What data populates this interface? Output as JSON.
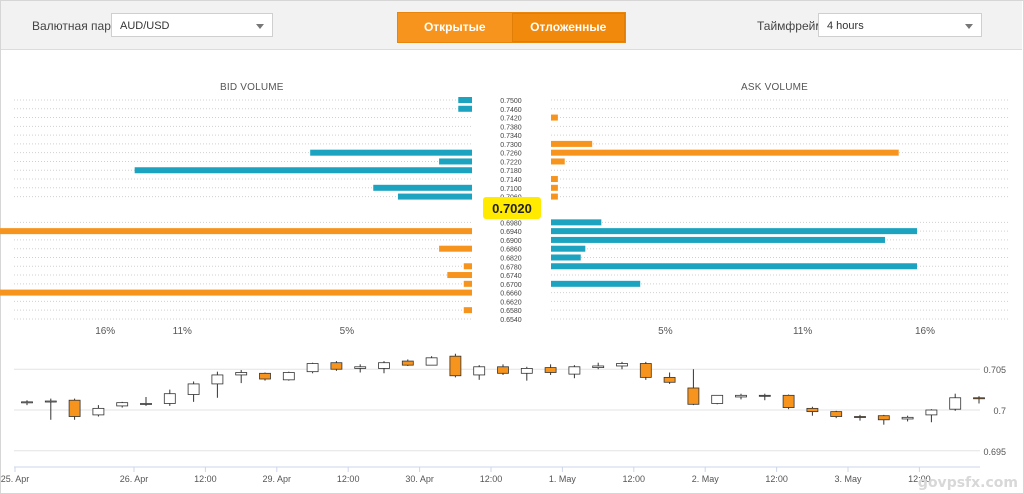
{
  "toolbar": {
    "pair_label": "Валютная пара",
    "pair_value": "AUD/USD",
    "tabs": [
      "Открытые",
      "Отложенные"
    ],
    "timeframe_label": "Таймфрейм",
    "timeframe_value": "4 hours"
  },
  "colors": {
    "bid_primary": "#1ba3bf",
    "ask_primary": "#f7941d",
    "price_highlight": "#ffea00"
  },
  "chart_data": [
    {
      "type": "bar",
      "orientation": "horizontal",
      "title_bid": "BID VOLUME",
      "title_ask": "ASK VOLUME",
      "current_price": "0.7020",
      "price_levels": [
        "0.7500",
        "0.7460",
        "0.7420",
        "0.7380",
        "0.7340",
        "0.7300",
        "0.7260",
        "0.7220",
        "0.7180",
        "0.7140",
        "0.7100",
        "0.7060",
        "0.6980",
        "0.6940",
        "0.6900",
        "0.6860",
        "0.6820",
        "0.6780",
        "0.6740",
        "0.6700",
        "0.6660",
        "0.6620",
        "0.6580",
        "0.6540"
      ],
      "bid": [
        {
          "price": "0.7500",
          "value": 0.5,
          "color": "teal"
        },
        {
          "price": "0.7460",
          "value": 0.5,
          "color": "teal"
        },
        {
          "price": "0.7420",
          "value": 0,
          "color": ""
        },
        {
          "price": "0.7380",
          "value": 0,
          "color": ""
        },
        {
          "price": "0.7340",
          "value": 0,
          "color": ""
        },
        {
          "price": "0.7300",
          "value": 0,
          "color": ""
        },
        {
          "price": "0.7260",
          "value": 5.9,
          "color": "teal"
        },
        {
          "price": "0.7220",
          "value": 1.2,
          "color": "teal"
        },
        {
          "price": "0.7180",
          "value": 12.3,
          "color": "teal"
        },
        {
          "price": "0.7140",
          "value": 0,
          "color": ""
        },
        {
          "price": "0.7100",
          "value": 3.6,
          "color": "teal"
        },
        {
          "price": "0.7060",
          "value": 2.7,
          "color": "teal"
        },
        {
          "price": "0.6980",
          "value": 0,
          "color": ""
        },
        {
          "price": "0.6940",
          "value": 40.0,
          "color": "orange"
        },
        {
          "price": "0.6900",
          "value": 0,
          "color": ""
        },
        {
          "price": "0.6860",
          "value": 1.2,
          "color": "orange"
        },
        {
          "price": "0.6820",
          "value": 0,
          "color": ""
        },
        {
          "price": "0.6780",
          "value": 0.3,
          "color": "orange"
        },
        {
          "price": "0.6740",
          "value": 0.9,
          "color": "orange"
        },
        {
          "price": "0.6700",
          "value": 0.3,
          "color": "orange"
        },
        {
          "price": "0.6660",
          "value": 30.0,
          "color": "orange"
        },
        {
          "price": "0.6620",
          "value": 0,
          "color": ""
        },
        {
          "price": "0.6580",
          "value": 0.3,
          "color": "orange"
        },
        {
          "price": "0.6540",
          "value": 0,
          "color": ""
        }
      ],
      "ask": [
        {
          "price": "0.7500",
          "value": 0,
          "color": ""
        },
        {
          "price": "0.7460",
          "value": 0,
          "color": ""
        },
        {
          "price": "0.7420",
          "value": 0.3,
          "color": "orange"
        },
        {
          "price": "0.7380",
          "value": 0,
          "color": ""
        },
        {
          "price": "0.7340",
          "value": 0,
          "color": ""
        },
        {
          "price": "0.7300",
          "value": 1.8,
          "color": "orange"
        },
        {
          "price": "0.7260",
          "value": 15.2,
          "color": "orange"
        },
        {
          "price": "0.7220",
          "value": 0.6,
          "color": "orange"
        },
        {
          "price": "0.7180",
          "value": 0,
          "color": ""
        },
        {
          "price": "0.7140",
          "value": 0.3,
          "color": "orange"
        },
        {
          "price": "0.7100",
          "value": 0.3,
          "color": "orange"
        },
        {
          "price": "0.7060",
          "value": 0.3,
          "color": "orange"
        },
        {
          "price": "0.6980",
          "value": 2.2,
          "color": "teal"
        },
        {
          "price": "0.6940",
          "value": 16.0,
          "color": "teal"
        },
        {
          "price": "0.6900",
          "value": 14.6,
          "color": "teal"
        },
        {
          "price": "0.6860",
          "value": 1.5,
          "color": "teal"
        },
        {
          "price": "0.6820",
          "value": 1.3,
          "color": "teal"
        },
        {
          "price": "0.6780",
          "value": 16.0,
          "color": "teal"
        },
        {
          "price": "0.6740",
          "value": 0,
          "color": ""
        },
        {
          "price": "0.6700",
          "value": 3.9,
          "color": "teal"
        },
        {
          "price": "0.6660",
          "value": 0,
          "color": ""
        },
        {
          "price": "0.6620",
          "value": 0,
          "color": ""
        },
        {
          "price": "0.6580",
          "value": 0,
          "color": ""
        },
        {
          "price": "0.6540",
          "value": 0,
          "color": ""
        }
      ],
      "bid_ticks": [
        {
          "label": "16%",
          "value": 16
        },
        {
          "label": "11%",
          "value": 11
        },
        {
          "label": "5%",
          "value": 5
        }
      ],
      "ask_ticks": [
        {
          "label": "5%",
          "value": 5
        },
        {
          "label": "11%",
          "value": 11
        },
        {
          "label": "16%",
          "value": 16
        }
      ],
      "xlim": [
        0,
        17
      ]
    },
    {
      "type": "candlestick",
      "ylim": [
        0.6935,
        0.7065
      ],
      "y_ticks": [
        {
          "label": "0.705",
          "value": 0.705
        },
        {
          "label": "0.7",
          "value": 0.7
        },
        {
          "label": "0.695",
          "value": 0.695
        }
      ],
      "x_labels": [
        "25. Apr",
        "26. Apr",
        "12:00",
        "29. Apr",
        "12:00",
        "30. Apr",
        "12:00",
        "1. May",
        "12:00",
        "2. May",
        "12:00",
        "3. May",
        "12:00"
      ],
      "x_label_index": [
        0,
        5,
        8,
        11,
        14,
        17,
        20,
        23,
        26,
        29,
        32,
        35,
        38
      ],
      "candles": [
        [
          0.7009,
          0.7012,
          0.7006,
          0.701
        ],
        [
          0.701,
          0.7014,
          0.6988,
          0.7011
        ],
        [
          0.7012,
          0.7014,
          0.6988,
          0.6992
        ],
        [
          0.6994,
          0.7006,
          0.6992,
          0.7002
        ],
        [
          0.7005,
          0.701,
          0.7003,
          0.7009
        ],
        [
          0.7007,
          0.7016,
          0.7005,
          0.7008
        ],
        [
          0.7008,
          0.7025,
          0.7005,
          0.702
        ],
        [
          0.7019,
          0.7035,
          0.701,
          0.7032
        ],
        [
          0.7032,
          0.7047,
          0.7015,
          0.7043
        ],
        [
          0.7043,
          0.7049,
          0.7033,
          0.7046
        ],
        [
          0.7045,
          0.7046,
          0.7036,
          0.7038
        ],
        [
          0.7037,
          0.7047,
          0.7036,
          0.7046
        ],
        [
          0.7047,
          0.7058,
          0.7045,
          0.7057
        ],
        [
          0.7058,
          0.706,
          0.7048,
          0.705
        ],
        [
          0.7051,
          0.7056,
          0.7046,
          0.7053
        ],
        [
          0.7051,
          0.706,
          0.7045,
          0.7058
        ],
        [
          0.706,
          0.7062,
          0.7054,
          0.7055
        ],
        [
          0.7055,
          0.7066,
          0.7055,
          0.7064
        ],
        [
          0.7066,
          0.7069,
          0.704,
          0.7042
        ],
        [
          0.7043,
          0.7055,
          0.7037,
          0.7053
        ],
        [
          0.7053,
          0.7056,
          0.7043,
          0.7045
        ],
        [
          0.7045,
          0.7053,
          0.7036,
          0.7051
        ],
        [
          0.7052,
          0.7056,
          0.7043,
          0.7046
        ],
        [
          0.7044,
          0.7055,
          0.7039,
          0.7053
        ],
        [
          0.7052,
          0.7058,
          0.705,
          0.7054
        ],
        [
          0.7054,
          0.7059,
          0.705,
          0.7057
        ],
        [
          0.7057,
          0.7059,
          0.7037,
          0.704
        ],
        [
          0.704,
          0.7046,
          0.7032,
          0.7034
        ],
        [
          0.7027,
          0.705,
          0.7006,
          0.7007
        ],
        [
          0.7008,
          0.7018,
          0.7007,
          0.7018
        ],
        [
          0.7016,
          0.702,
          0.7013,
          0.7018
        ],
        [
          0.7018,
          0.702,
          0.7012,
          0.7017
        ],
        [
          0.7018,
          0.7019,
          0.7001,
          0.7003
        ],
        [
          0.7002,
          0.7004,
          0.6993,
          0.6998
        ],
        [
          0.6998,
          0.6999,
          0.699,
          0.6992
        ],
        [
          0.6992,
          0.6994,
          0.6987,
          0.6991
        ],
        [
          0.6993,
          0.6994,
          0.6982,
          0.6988
        ],
        [
          0.6989,
          0.6993,
          0.6986,
          0.6991
        ],
        [
          0.6994,
          0.7001,
          0.6985,
          0.7
        ],
        [
          0.7001,
          0.702,
          0.6999,
          0.7015
        ],
        [
          0.7015,
          0.7017,
          0.7008,
          0.7014
        ]
      ]
    }
  ],
  "watermark": "govpsfx.com"
}
